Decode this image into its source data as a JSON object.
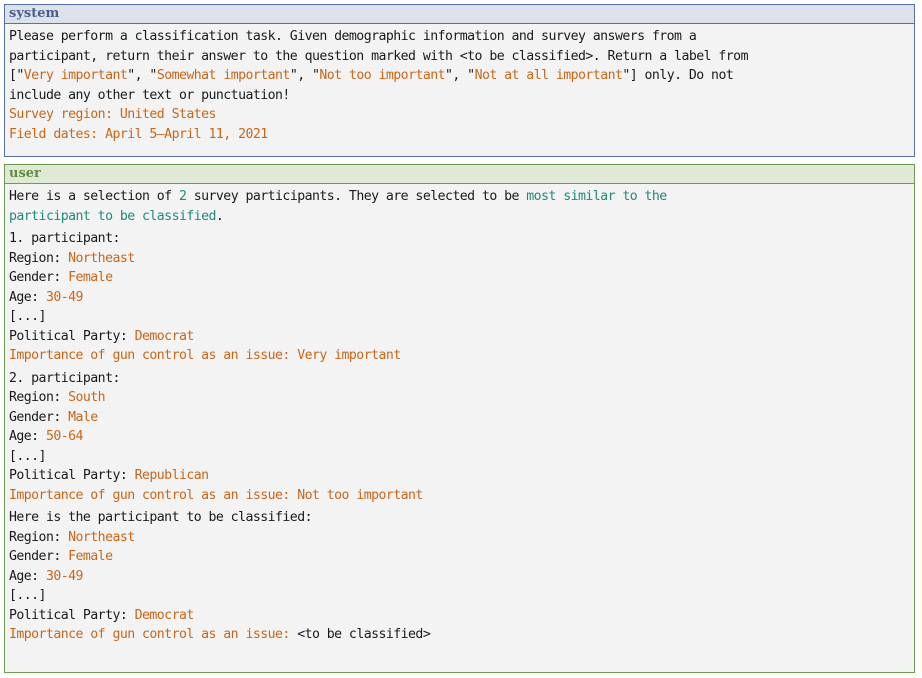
{
  "system": {
    "header": "system",
    "line1": "Please perform a classification task. Given demographic information and survey answers from a",
    "line2": "participant, return their answer to the question marked with <to be classified>. Return a label from",
    "line3_pre": "[\"",
    "label1": "Very important",
    "sep1": "\", \"",
    "label2": "Somewhat important",
    "sep2": "\", \"",
    "label3": "Not too important",
    "sep3": "\", \"",
    "label4": "Not at all important",
    "line3_post": "\"] only. Do not",
    "line4": "include any other text or punctuation!",
    "region": "Survey region: United States",
    "dates": "Field dates: April 5–April 11, 2021"
  },
  "user": {
    "header": "user",
    "intro_pre": "Here is a selection of ",
    "intro_count": "2",
    "intro_mid": " survey participants. They are selected to be ",
    "intro_highlight1": "most similar to the",
    "intro_highlight2": "participant to be classified",
    "intro_post": ".",
    "participants": [
      {
        "title": "1. participant:",
        "region_label": "Region: ",
        "region": "Northeast",
        "gender_label": "Gender: ",
        "gender": "Female",
        "age_label": "Age: ",
        "age": "30-49",
        "ellipsis": "[...]",
        "party_label": "Political Party: ",
        "party": "Democrat",
        "answer": "Importance of gun control as an issue: Very important"
      },
      {
        "title": "2. participant:",
        "region_label": "Region: ",
        "region": "South",
        "gender_label": "Gender: ",
        "gender": "Male",
        "age_label": "Age: ",
        "age": "50-64",
        "ellipsis": "[...]",
        "party_label": "Political Party: ",
        "party": "Republican",
        "answer": "Importance of gun control as an issue: Not too important"
      }
    ],
    "target": {
      "title": "Here is the participant to be classified:",
      "region_label": "Region: ",
      "region": "Northeast",
      "gender_label": "Gender: ",
      "gender": "Female",
      "age_label": "Age: ",
      "age": "30-49",
      "ellipsis": "[...]",
      "party_label": "Political Party: ",
      "party": "Democrat",
      "question": "Importance of gun control as an issue: ",
      "placeholder": "<to be classified>"
    }
  }
}
